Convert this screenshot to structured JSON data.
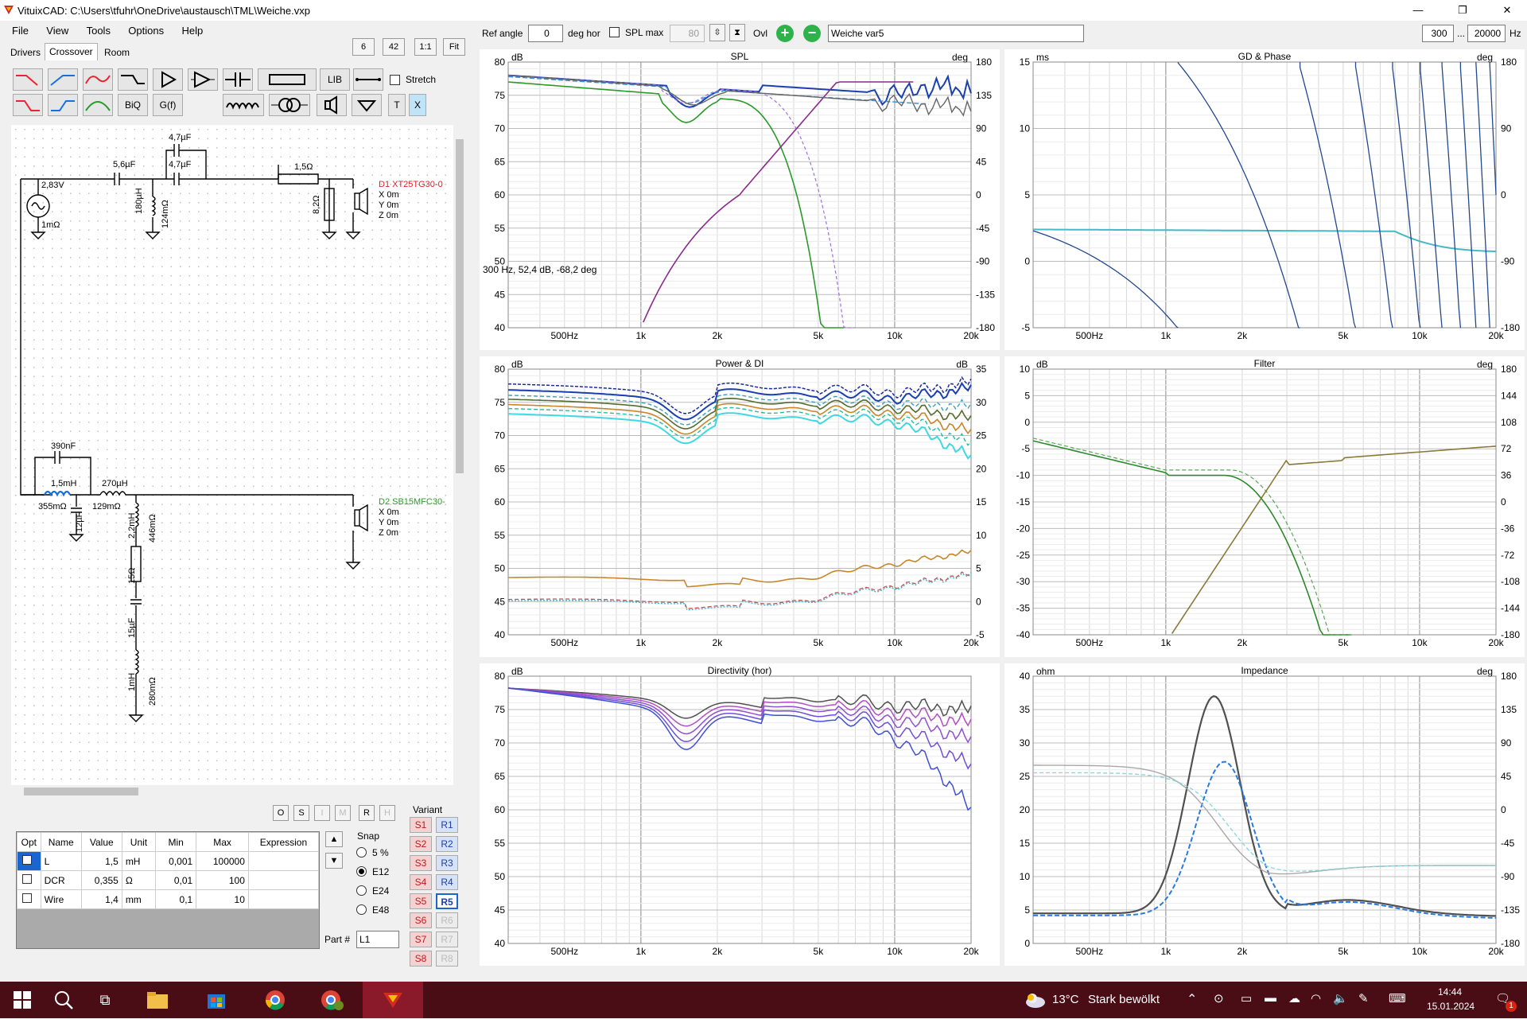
{
  "window": {
    "title": "VituixCAD: C:\\Users\\tfuhr\\OneDrive\\austausch\\TML\\Weiche.vxp",
    "minimize": "—",
    "restore": "❐",
    "close": "✕"
  },
  "menu": [
    "File",
    "View",
    "Tools",
    "Options",
    "Help"
  ],
  "tabs": [
    "Drivers",
    "Crossover",
    "Room"
  ],
  "zoom_buttons": [
    "6",
    "42",
    "1:1",
    "Fit"
  ],
  "toolbar": {
    "lib": "LIB",
    "biq": "BiQ",
    "gf": "G(f)",
    "stretch": "Stretch",
    "t": "T",
    "x": "X"
  },
  "top_controls": {
    "ref_angle_label": "Ref angle",
    "ref_angle_value": "0",
    "deg_hor": "deg hor",
    "spl_max_label": "SPL max",
    "spl_max_value": "80",
    "ovl": "Ovl",
    "variant_name": "Weiche var5",
    "freq_from": "300",
    "ellipsis": "...",
    "freq_to": "20000",
    "hz": "Hz"
  },
  "schematic": {
    "source_v": "2,83V",
    "source_r": "1mΩ",
    "c1": "5,6µF",
    "c2": "4,7µF",
    "c3": "4,7µF",
    "l1": "180µH",
    "l1r": "124mΩ",
    "r1": "1,5Ω",
    "r2": "8,2Ω",
    "d1": "D1 XT25TG30-0",
    "d1x": "X 0m",
    "d1y": "Y 0m",
    "d1z": "Z 0m",
    "c4": "390nF",
    "l2": "1,5mH",
    "l2r": "355mΩ",
    "l3": "270µH",
    "l3r": "129mΩ",
    "c5": "12µF",
    "l4": "2,2mH",
    "l4r": "446mΩ",
    "r3": "15Ω",
    "c6": "15µF",
    "l5": "1mH",
    "l5r": "280mΩ",
    "d2": "D2 SB15MFC30-",
    "d2x": "X 0m",
    "d2y": "Y 0m",
    "d2z": "Z 0m"
  },
  "mode_buttons": [
    "O",
    "S",
    "I",
    "M",
    "R",
    "H"
  ],
  "prop_table": {
    "headers": [
      "Opt",
      "Name",
      "Value",
      "Unit",
      "Min",
      "Max",
      "Expression"
    ],
    "rows": [
      {
        "name": "L",
        "value": "1,5",
        "unit": "mH",
        "min": "0,001",
        "max": "100000"
      },
      {
        "name": "DCR",
        "value": "0,355",
        "unit": "Ω",
        "min": "0,01",
        "max": "100"
      },
      {
        "name": "Wire",
        "value": "1,4",
        "unit": "mm",
        "min": "0,1",
        "max": "10"
      }
    ]
  },
  "snap": {
    "label": "Snap",
    "options": [
      "5 %",
      "E12",
      "E24",
      "E48"
    ],
    "selected": "E12"
  },
  "part_label": "Part #",
  "part_value": "L1",
  "variant": {
    "label": "Variant",
    "s": [
      "S1",
      "S2",
      "S3",
      "S4",
      "S5",
      "S6",
      "S7",
      "S8"
    ],
    "r": [
      "R1",
      "R2",
      "R3",
      "R4",
      "R5",
      "R6",
      "R7",
      "R8"
    ],
    "active": "R5"
  },
  "x_ticks": [
    "500Hz",
    "1k",
    "2k",
    "5k",
    "10k",
    "20k"
  ],
  "charts": [
    {
      "id": "spl",
      "title": "SPL",
      "left_unit": "dB",
      "right_unit": "deg",
      "left_ticks": [
        "80",
        "75",
        "70",
        "65",
        "60",
        "55",
        "50",
        "45",
        "40"
      ],
      "right_ticks": [
        "180",
        "135",
        "90",
        "45",
        "0",
        "-45",
        "-90",
        "-135",
        "-180"
      ],
      "annotation": "300 Hz, 52,4 dB, -68,2 deg"
    },
    {
      "id": "gd",
      "title": "GD & Phase",
      "left_unit": "ms",
      "right_unit": "deg",
      "left_ticks": [
        "15",
        "10",
        "5",
        "0",
        "-5"
      ],
      "right_ticks": [
        "180",
        "90",
        "0",
        "-90",
        "-180"
      ]
    },
    {
      "id": "power",
      "title": "Power & DI",
      "left_unit": "dB",
      "right_unit": "dB",
      "left_ticks": [
        "80",
        "75",
        "70",
        "65",
        "60",
        "55",
        "50",
        "45",
        "40"
      ],
      "right_ticks": [
        "35",
        "30",
        "25",
        "20",
        "15",
        "10",
        "5",
        "0",
        "-5"
      ]
    },
    {
      "id": "filter",
      "title": "Filter",
      "left_unit": "dB",
      "right_unit": "deg",
      "left_ticks": [
        "10",
        "5",
        "0",
        "-5",
        "-10",
        "-15",
        "-20",
        "-25",
        "-30",
        "-35",
        "-40"
      ],
      "right_ticks": [
        "180",
        "144",
        "108",
        "72",
        "36",
        "0",
        "-36",
        "-72",
        "-108",
        "-144",
        "-180"
      ]
    },
    {
      "id": "dir",
      "title": "Directivity (hor)",
      "left_unit": "dB",
      "right_unit": "",
      "left_ticks": [
        "80",
        "75",
        "70",
        "65",
        "60",
        "55",
        "50",
        "45",
        "40"
      ],
      "right_ticks": []
    },
    {
      "id": "imp",
      "title": "Impedance",
      "left_unit": "ohm",
      "right_unit": "deg",
      "left_ticks": [
        "40",
        "35",
        "30",
        "25",
        "20",
        "15",
        "10",
        "5",
        "0"
      ],
      "right_ticks": [
        "180",
        "135",
        "90",
        "45",
        "0",
        "-45",
        "-90",
        "-135",
        "-180"
      ]
    }
  ],
  "taskbar": {
    "weather_temp": "13°C",
    "weather_text": "Stark bewölkt",
    "time": "14:44",
    "date": "15.01.2024",
    "notif": "1"
  }
}
